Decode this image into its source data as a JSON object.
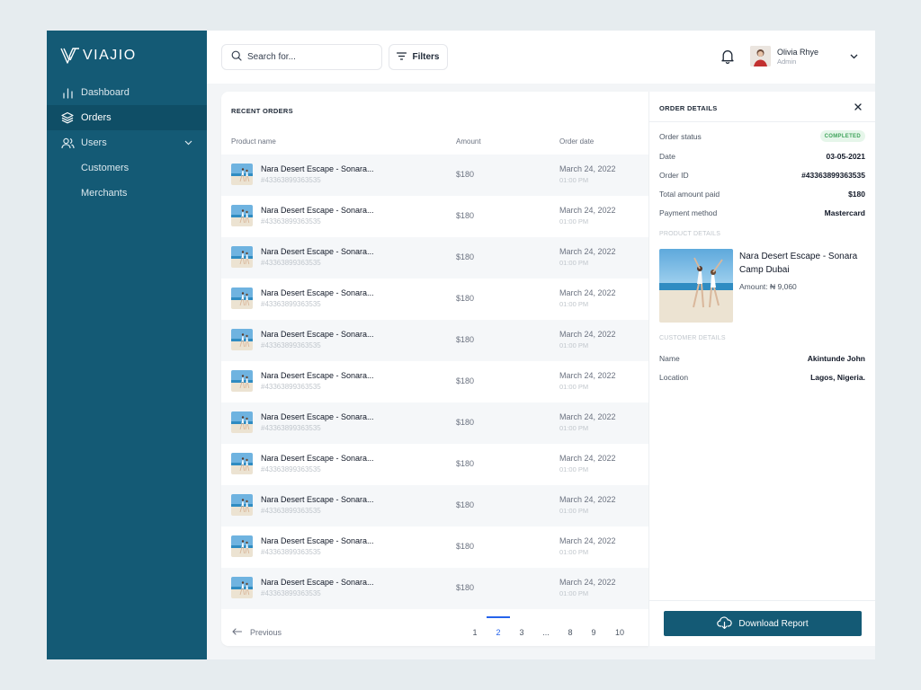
{
  "brand": {
    "name": "VIAJIO"
  },
  "sidebar": {
    "items": [
      {
        "label": "Dashboard",
        "icon": "bar-chart-icon"
      },
      {
        "label": "Orders",
        "icon": "layers-icon",
        "active": true
      },
      {
        "label": "Users",
        "icon": "users-icon",
        "expanded": true
      }
    ],
    "sub_items": [
      {
        "label": "Customers"
      },
      {
        "label": "Merchants"
      }
    ]
  },
  "header": {
    "search_placeholder": "Search for...",
    "filters_label": "Filters",
    "user": {
      "name": "Olivia Rhye",
      "role": "Admin"
    }
  },
  "orders": {
    "title": "RECENT ORDERS",
    "columns": {
      "product": "Product name",
      "amount": "Amount",
      "date": "Order date"
    },
    "rows": [
      {
        "name": "Nara Desert Escape - Sonara...",
        "id": "#43363899363535",
        "amount": "$180",
        "date": "March 24, 2022",
        "time": "01:00 PM"
      },
      {
        "name": "Nara Desert Escape - Sonara...",
        "id": "#43363899363535",
        "amount": "$180",
        "date": "March 24, 2022",
        "time": "01:00 PM"
      },
      {
        "name": "Nara Desert Escape - Sonara...",
        "id": "#43363899363535",
        "amount": "$180",
        "date": "March 24, 2022",
        "time": "01:00 PM"
      },
      {
        "name": "Nara Desert Escape - Sonara...",
        "id": "#43363899363535",
        "amount": "$180",
        "date": "March 24, 2022",
        "time": "01:00 PM"
      },
      {
        "name": "Nara Desert Escape - Sonara...",
        "id": "#43363899363535",
        "amount": "$180",
        "date": "March 24, 2022",
        "time": "01:00 PM"
      },
      {
        "name": "Nara Desert Escape - Sonara...",
        "id": "#43363899363535",
        "amount": "$180",
        "date": "March 24, 2022",
        "time": "01:00 PM"
      },
      {
        "name": "Nara Desert Escape - Sonara...",
        "id": "#43363899363535",
        "amount": "$180",
        "date": "March 24, 2022",
        "time": "01:00 PM"
      },
      {
        "name": "Nara Desert Escape - Sonara...",
        "id": "#43363899363535",
        "amount": "$180",
        "date": "March 24, 2022",
        "time": "01:00 PM"
      },
      {
        "name": "Nara Desert Escape - Sonara...",
        "id": "#43363899363535",
        "amount": "$180",
        "date": "March 24, 2022",
        "time": "01:00 PM"
      },
      {
        "name": "Nara Desert Escape - Sonara...",
        "id": "#43363899363535",
        "amount": "$180",
        "date": "March 24, 2022",
        "time": "01:00 PM"
      },
      {
        "name": "Nara Desert Escape - Sonara...",
        "id": "#43363899363535",
        "amount": "$180",
        "date": "March 24, 2022",
        "time": "01:00 PM"
      }
    ],
    "pagination": {
      "previous_label": "Previous",
      "pages": [
        "1",
        "2",
        "3",
        "...",
        "8",
        "9",
        "10"
      ],
      "current": "2"
    }
  },
  "details": {
    "title": "ORDER DETAILS",
    "status_label": "Order status",
    "status": "COMPLETED",
    "fields": [
      {
        "label": "Date",
        "value": "03-05-2021"
      },
      {
        "label": "Order ID",
        "value": "#43363899363535"
      },
      {
        "label": "Total amount paid",
        "value": "$180"
      },
      {
        "label": "Payment method",
        "value": "Mastercard"
      }
    ],
    "product_section": "PRODUCT DETAILS",
    "product": {
      "name": "Nara Desert Escape - Sonara Camp Dubai",
      "amount": "Amount: ₦ 9,060"
    },
    "customer_section": "CUSTOMER DETAILS",
    "customer": [
      {
        "label": "Name",
        "value": "Akintunde John"
      },
      {
        "label": "Location",
        "value": "Lagos, Nigeria."
      }
    ],
    "download_label": "Download Report"
  },
  "colors": {
    "sidebar": "#145a75",
    "sidebar_active": "#0f4e66",
    "accent": "#2563eb",
    "success_bg": "#e6f6ea",
    "success_text": "#3fa35a"
  }
}
